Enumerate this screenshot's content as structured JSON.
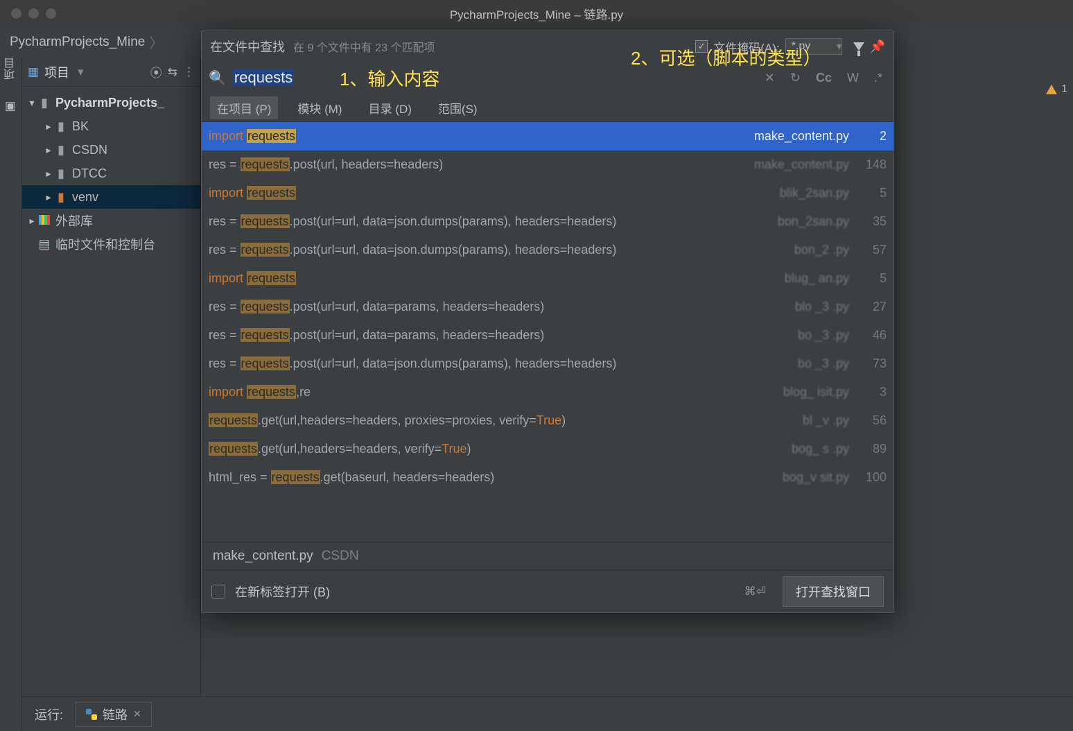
{
  "window_title": "PycharmProjects_Mine – 链路.py",
  "breadcrumb": {
    "root": "PycharmProjects_Mine"
  },
  "sidebar": {
    "title": "项目",
    "tree": {
      "root": "PycharmProjects_",
      "children": [
        "BK",
        "CSDN",
        "DTCC",
        "venv"
      ],
      "external_lib": "外部库",
      "scratch": "临时文件和控制台"
    }
  },
  "warning_count": "1",
  "annotations": {
    "a1": "1、输入内容",
    "a2": "2、可选（脚本的类型）"
  },
  "find": {
    "title": "在文件中查找",
    "stats": "在 9 个文件中有 23 个匹配项",
    "mask_label": "文件掩码(A):",
    "mask_value": "*.py",
    "query": "requests",
    "options": {
      "cc": "Cc",
      "w": "W",
      "regex": ".*"
    },
    "scopes": {
      "project": "在项目 (P)",
      "module": "模块 (M)",
      "directory": "目录 (D)",
      "scope": "范围(S)"
    },
    "preview": {
      "file": "make_content.py",
      "dir": "CSDN"
    },
    "footer": {
      "newtab": "在新标签打开 (B)",
      "shortcut": "⌘⏎",
      "open": "打开查找窗口"
    },
    "results": [
      {
        "pre": "import ",
        "post": "",
        "imp": true,
        "file": "make_content.py",
        "line": 2,
        "blur": false
      },
      {
        "pre": "res = ",
        "post": ".post(url, headers=headers)",
        "file": "make_content.py",
        "line": 148,
        "blur": true
      },
      {
        "pre": "import ",
        "post": "",
        "imp": true,
        "file": "blik_2san.py",
        "line": 5,
        "blur": true
      },
      {
        "pre": "res = ",
        "post": ".post(url=url, data=json.dumps(params), headers=headers)",
        "file": "bon_2san.py",
        "line": 35,
        "blur": true
      },
      {
        "pre": "res = ",
        "post": ".post(url=url, data=json.dumps(params), headers=headers)",
        "file": "bon_2   .py",
        "line": 57,
        "blur": true
      },
      {
        "pre": "import ",
        "post": "",
        "imp": true,
        "file": "blug_ an.py",
        "line": 5,
        "blur": true
      },
      {
        "pre": "res = ",
        "post": ".post(url=url, data=params, headers=headers)",
        "file": "blo _3  .py",
        "line": 27,
        "blur": true
      },
      {
        "pre": "res = ",
        "post": ".post(url=url, data=params, headers=headers)",
        "file": "bo _3  .py",
        "line": 46,
        "blur": true
      },
      {
        "pre": "res = ",
        "post": ".post(url=url, data=json.dumps(params), headers=headers)",
        "file": "bo _3  .py",
        "line": 73,
        "blur": true
      },
      {
        "pre": "import ",
        "post": ",re",
        "imp": true,
        "file": "blog_ isit.py",
        "line": 3,
        "blur": true
      },
      {
        "pre": "",
        "post": ".get(url,headers=headers, proxies=proxies, verify=True)",
        "bool": true,
        "file": "bl _v  .py",
        "line": 56,
        "blur": true
      },
      {
        "pre": "",
        "post": ".get(url,headers=headers, verify=True)",
        "bool": true,
        "file": "bog_ s .py",
        "line": 89,
        "blur": true
      },
      {
        "pre": "html_res = ",
        "post": ".get(baseurl, headers=headers)",
        "file": "bog_v sit.py",
        "line": 100,
        "blur": true
      }
    ]
  },
  "run": {
    "label": "运行:",
    "tab": "链路"
  }
}
